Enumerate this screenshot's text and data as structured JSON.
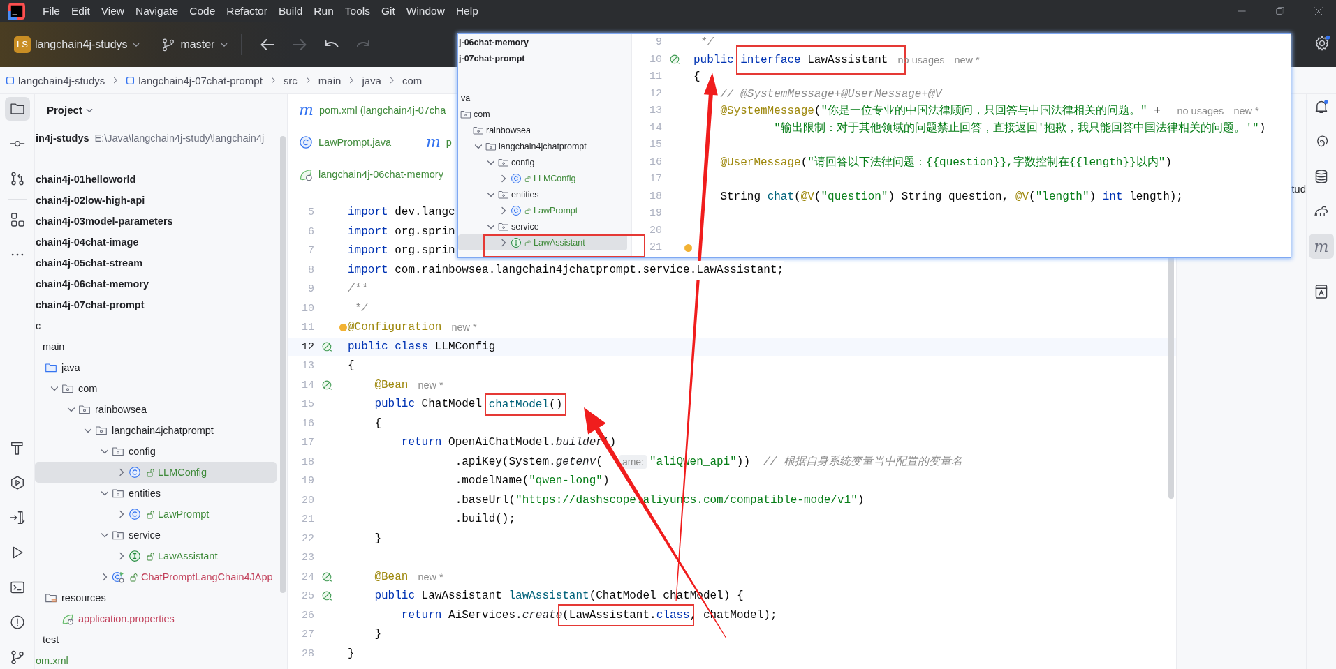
{
  "menu": [
    "File",
    "Edit",
    "View",
    "Navigate",
    "Code",
    "Refactor",
    "Build",
    "Run",
    "Tools",
    "Git",
    "Window",
    "Help"
  ],
  "toolbar": {
    "project_badge": "LS",
    "project": "langchain4j-studys",
    "branch": "master",
    "nav_buttons": [
      {
        "kind": "back",
        "disabled": false
      },
      {
        "kind": "forward",
        "disabled": true
      },
      {
        "kind": "undo",
        "disabled": false
      },
      {
        "kind": "redo",
        "disabled": true
      }
    ]
  },
  "breadcrumbs": [
    {
      "label": "langchain4j-studys",
      "kind": "module"
    },
    {
      "label": "langchain4j-07chat-prompt",
      "kind": "module"
    },
    {
      "label": "src"
    },
    {
      "label": "main"
    },
    {
      "label": "java"
    },
    {
      "label": "com"
    }
  ],
  "left_toolbar": {
    "top": [
      {
        "kind": "project",
        "selected": true
      },
      {
        "kind": "commit",
        "selected": false
      },
      {
        "kind": "pull_requests",
        "selected": false
      },
      {
        "kind": "structure",
        "selected": false
      },
      {
        "kind": "more",
        "selected": false
      }
    ],
    "bottom": [
      {
        "kind": "build",
        "selected": false
      },
      {
        "kind": "services",
        "selected": false
      },
      {
        "kind": "deploy",
        "selected": false
      },
      {
        "kind": "run",
        "selected": false
      },
      {
        "kind": "terminal",
        "selected": false
      },
      {
        "kind": "problems",
        "selected": false
      },
      {
        "kind": "git",
        "selected": false
      }
    ]
  },
  "project_panel": {
    "title": "Project",
    "tree": [
      {
        "label": "in4j-studys",
        "kind": "project",
        "path": "E:\\Java\\langchain4j-study\\langchain4j",
        "selected": false,
        "children": [
          {
            "label": "chain4j-01helloworld",
            "kind": "module",
            "selected": false
          },
          {
            "label": "chain4j-02low-high-api",
            "kind": "module",
            "selected": false
          },
          {
            "label": "chain4j-03model-parameters",
            "kind": "module",
            "selected": false
          },
          {
            "label": "chain4j-04chat-image",
            "kind": "module",
            "selected": false
          },
          {
            "label": "chain4j-05chat-stream",
            "kind": "module",
            "selected": false
          },
          {
            "label": "chain4j-06chat-memory",
            "kind": "module",
            "selected": false
          },
          {
            "label": "chain4j-07chat-prompt",
            "kind": "module",
            "selected": false,
            "children": [
              {
                "label": "c",
                "selected": false,
                "children": [
                  {
                    "label": "main",
                    "selected": false,
                    "children": [
                      {
                        "label": "java",
                        "kind": "source_root",
                        "selected": false,
                        "children": [
                          {
                            "label": "com",
                            "kind": "package",
                            "expanded": true,
                            "selected": false,
                            "children": [
                              {
                                "label": "rainbowsea",
                                "kind": "package",
                                "expanded": true,
                                "selected": false,
                                "children": [
                                  {
                                    "label": "langchain4jchatprompt",
                                    "kind": "package",
                                    "expanded": true,
                                    "selected": false,
                                    "children": [
                                      {
                                        "label": "config",
                                        "kind": "package",
                                        "expanded": true,
                                        "selected": false,
                                        "children": [
                                          {
                                            "label": "LLMConfig",
                                            "kind": "class",
                                            "expanded": false,
                                            "selected": true,
                                            "color": "#3f8a3a"
                                          }
                                        ]
                                      },
                                      {
                                        "label": "entities",
                                        "kind": "package",
                                        "expanded": true,
                                        "selected": false,
                                        "children": [
                                          {
                                            "label": "LawPrompt",
                                            "kind": "class",
                                            "expanded": false,
                                            "selected": false,
                                            "color": "#3f8a3a"
                                          }
                                        ]
                                      },
                                      {
                                        "label": "service",
                                        "kind": "package",
                                        "expanded": true,
                                        "selected": false,
                                        "children": [
                                          {
                                            "label": "LawAssistant",
                                            "kind": "interface",
                                            "expanded": false,
                                            "selected": false,
                                            "color": "#3f8a3a"
                                          }
                                        ]
                                      },
                                      {
                                        "label": "ChatPromptLangChain4JApp",
                                        "kind": "app",
                                        "expanded": false,
                                        "selected": false,
                                        "color": "#c2415b"
                                      }
                                    ]
                                  }
                                ]
                              }
                            ]
                          }
                        ]
                      },
                      {
                        "label": "resources",
                        "kind": "resources",
                        "selected": false,
                        "children": [
                          {
                            "label": "application.properties",
                            "kind": "properties",
                            "selected": false,
                            "color": "#c2415b"
                          }
                        ]
                      }
                    ]
                  },
                  {
                    "label": "test",
                    "selected": false
                  }
                ]
              },
              {
                "label": "om.xml",
                "selected": false,
                "color": "#3f8a3a"
              }
            ]
          }
        ]
      }
    ]
  },
  "editor": {
    "tab_rows": [
      [
        {
          "kind": "maven",
          "icon_text": "m",
          "label": "pom.xml (langchain4j-07cha"
        }
      ],
      [
        {
          "kind": "class",
          "label": "LawPrompt.java"
        },
        {
          "kind": "maven",
          "icon_text": "m",
          "label": "p"
        }
      ],
      [
        {
          "kind": "spring",
          "label": "langchain4j-06chat-memory"
        }
      ]
    ],
    "lines": [
      {
        "number": "5",
        "current": false,
        "segments": [
          {
            "kind": "keyword",
            "text": "import"
          },
          {
            "kind": "plain",
            "text": " dev.langc"
          }
        ]
      },
      {
        "number": "6",
        "current": false,
        "segments": [
          {
            "kind": "keyword",
            "text": "import"
          },
          {
            "kind": "plain",
            "text": " org.sprin"
          }
        ]
      },
      {
        "number": "7",
        "current": false,
        "segments": [
          {
            "kind": "keyword",
            "text": "import"
          },
          {
            "kind": "plain",
            "text": " org.sprin"
          }
        ]
      },
      {
        "number": "8",
        "current": false,
        "segments": [
          {
            "kind": "keyword",
            "text": "import"
          },
          {
            "kind": "plain",
            "text": " com.rainbowsea.langchain4jchatprompt.service.LawAssistant;"
          }
        ]
      },
      {
        "number": "9",
        "current": false,
        "segments": [
          {
            "kind": "comment",
            "text": "/**"
          }
        ]
      },
      {
        "number": "10",
        "current": false,
        "segments": [
          {
            "kind": "comment",
            "text": " */"
          }
        ]
      },
      {
        "number": "11",
        "current": false,
        "marker": {
          "kind": "bulb"
        },
        "segments": [
          {
            "kind": "annotation",
            "text": "@Configuration"
          },
          {
            "kind": "hint",
            "text": "new *"
          }
        ]
      },
      {
        "number": "12",
        "current": true,
        "gutter": {
          "kind": "bean"
        },
        "segments": [
          {
            "kind": "keyword",
            "text": "public class"
          },
          {
            "kind": "plain",
            "text": " LLMConfig"
          }
        ]
      },
      {
        "number": "13",
        "current": false,
        "segments": [
          {
            "kind": "plain",
            "text": "{"
          }
        ]
      },
      {
        "number": "14",
        "current": false,
        "gutter": {
          "kind": "bean"
        },
        "segments": [
          {
            "kind": "annotation",
            "text": "    @Bean"
          },
          {
            "kind": "hint",
            "text": "new *"
          }
        ]
      },
      {
        "number": "15",
        "current": false,
        "segments": [
          {
            "kind": "keyword",
            "text": "    public",
            "framed": false
          },
          {
            "kind": "plain",
            "text": " ChatModel ",
            "framed": false
          },
          {
            "kind": "method",
            "text": "chatModel",
            "framed": true
          },
          {
            "kind": "plain",
            "text": "()",
            "framed": true
          }
        ]
      },
      {
        "number": "16",
        "current": false,
        "segments": [
          {
            "kind": "plain",
            "text": "    {"
          }
        ]
      },
      {
        "number": "17",
        "current": false,
        "segments": [
          {
            "kind": "keyword",
            "text": "        return"
          },
          {
            "kind": "plain",
            "text": " OpenAiChatModel."
          },
          {
            "kind": "italic",
            "text": "builder"
          },
          {
            "kind": "plain",
            "text": "()"
          }
        ]
      },
      {
        "number": "18",
        "current": false,
        "segments": [
          {
            "kind": "plain",
            "text": "                .apiKey(System."
          },
          {
            "kind": "italic",
            "text": "getenv"
          },
          {
            "kind": "plain",
            "text": "("
          },
          {
            "kind": "param_hint",
            "text": "ame:"
          },
          {
            "kind": "string",
            "text": "\"aliQwen_api\""
          },
          {
            "kind": "plain",
            "text": "))  "
          },
          {
            "kind": "comment",
            "text": "// 根据自身系统变量当中配置的变量名"
          }
        ]
      },
      {
        "number": "19",
        "current": false,
        "segments": [
          {
            "kind": "plain",
            "text": "                .modelName("
          },
          {
            "kind": "string",
            "text": "\"qwen-long\""
          },
          {
            "kind": "plain",
            "text": ")"
          }
        ]
      },
      {
        "number": "20",
        "current": false,
        "segments": [
          {
            "kind": "plain",
            "text": "                .baseUrl("
          },
          {
            "kind": "string",
            "text": "\""
          },
          {
            "kind": "link",
            "text": "https://dashscope.aliyuncs.com/compatible-mode/v1"
          },
          {
            "kind": "string",
            "text": "\""
          },
          {
            "kind": "plain",
            "text": ")"
          }
        ]
      },
      {
        "number": "21",
        "current": false,
        "segments": [
          {
            "kind": "plain",
            "text": "                .build();"
          }
        ]
      },
      {
        "number": "22",
        "current": false,
        "segments": [
          {
            "kind": "plain",
            "text": "    }"
          }
        ]
      },
      {
        "number": "23",
        "current": false
      },
      {
        "number": "24",
        "current": false,
        "gutter": {
          "kind": "bean"
        },
        "segments": [
          {
            "kind": "annotation",
            "text": "    @Bean"
          },
          {
            "kind": "hint",
            "text": "new *"
          }
        ]
      },
      {
        "number": "25",
        "current": false,
        "gutter": {
          "kind": "bean"
        },
        "segments": [
          {
            "kind": "keyword",
            "text": "    public"
          },
          {
            "kind": "plain",
            "text": " LawAssistant "
          },
          {
            "kind": "method",
            "text": "lawAssistant"
          },
          {
            "kind": "plain",
            "text": "(ChatModel chatModel) {"
          }
        ]
      },
      {
        "number": "26",
        "current": false,
        "segments": [
          {
            "kind": "keyword",
            "text": "        return",
            "framed": false
          },
          {
            "kind": "plain",
            "text": " AiServices.",
            "framed": false
          },
          {
            "kind": "italic",
            "text": "create",
            "framed": false
          },
          {
            "kind": "plain",
            "text": "(LawAssistant.",
            "framed": true
          },
          {
            "kind": "keyword",
            "text": "class",
            "framed": true
          },
          {
            "kind": "plain",
            "text": ", chatModel);",
            "framed": false
          }
        ]
      },
      {
        "number": "27",
        "current": false,
        "segments": [
          {
            "kind": "plain",
            "text": "    }"
          }
        ]
      },
      {
        "number": "28",
        "current": false,
        "segments": [
          {
            "kind": "plain",
            "text": "}"
          }
        ]
      }
    ]
  },
  "right_panel": {
    "text": "tud"
  },
  "right_toolbar": [
    {
      "kind": "notifications",
      "selected": false
    },
    {
      "kind": "ai",
      "selected": false
    },
    {
      "kind": "database",
      "selected": false
    },
    {
      "kind": "gradle",
      "selected": false
    },
    {
      "kind": "maven",
      "label": "m",
      "selected": true
    },
    {
      "kind": "docs",
      "selected": false
    }
  ],
  "popup": {
    "tree": [
      {
        "label": "j-06chat-memory",
        "kind": "module",
        "selected": false
      },
      {
        "label": "j-07chat-prompt",
        "kind": "module",
        "selected": false,
        "children": [
          {
            "label": "va",
            "selected": false,
            "children": [
              {
                "label": "com",
                "kind": "package",
                "selected": false,
                "children": [
                  {
                    "label": "rainbowsea",
                    "kind": "package",
                    "selected": false,
                    "children": [
                      {
                        "label": "langchain4jchatprompt",
                        "kind": "package",
                        "expanded": true,
                        "selected": false,
                        "children": [
                          {
                            "label": "config",
                            "kind": "package",
                            "expanded": true,
                            "selected": false,
                            "children": [
                              {
                                "label": "LLMConfig",
                                "kind": "class",
                                "expanded": false,
                                "selected": false,
                                "color": "#3f8a3a"
                              }
                            ]
                          },
                          {
                            "label": "entities",
                            "kind": "package",
                            "expanded": true,
                            "selected": false,
                            "children": [
                              {
                                "label": "LawPrompt",
                                "kind": "class",
                                "expanded": false,
                                "selected": false,
                                "color": "#3f8a3a"
                              }
                            ]
                          },
                          {
                            "label": "service",
                            "kind": "package",
                            "expanded": true,
                            "selected": false,
                            "children": [
                              {
                                "label": "LawAssistant",
                                "kind": "interface",
                                "expanded": false,
                                "selected": true,
                                "color": "#3f8a3a"
                              }
                            ]
                          }
                        ]
                      }
                    ]
                  }
                ]
              }
            ]
          }
        ]
      }
    ],
    "lines": [
      {
        "number": "9",
        "segments": [
          {
            "kind": "comment",
            "text": " */"
          }
        ]
      },
      {
        "number": "10",
        "gutter": {
          "kind": "bean"
        },
        "segments": [
          {
            "kind": "keyword",
            "text": "public ",
            "framed": false
          },
          {
            "kind": "keyword",
            "text": "interface",
            "framed": true
          },
          {
            "kind": "plain",
            "text": " LawAssistant",
            "framed": true
          },
          {
            "kind": "hint",
            "text": "no usages"
          },
          {
            "kind": "hint",
            "text": "new *"
          }
        ]
      },
      {
        "number": "11",
        "segments": [
          {
            "kind": "plain",
            "text": "{"
          }
        ]
      },
      {
        "number": "12",
        "segments": [
          {
            "kind": "comment",
            "text": "    // @SystemMessage+@UserMessage+@V"
          }
        ]
      },
      {
        "number": "13",
        "segments": [
          {
            "kind": "annotation",
            "text": "    @SystemMessage"
          },
          {
            "kind": "plain",
            "text": "("
          },
          {
            "kind": "string",
            "text": "\"你是一位专业的中国法律顾问，只回答与中国法律相关的问题。\""
          },
          {
            "kind": "plain",
            "text": " + "
          },
          {
            "kind": "hint",
            "text": "no usages"
          },
          {
            "kind": "hint",
            "text": "new *"
          }
        ]
      },
      {
        "number": "14",
        "segments": [
          {
            "kind": "string",
            "text": "            \"输出限制：对于其他领域的问题禁止回答，直接返回'抱歉，我只能回答中国法律相关的问题。'\""
          },
          {
            "kind": "plain",
            "text": ")"
          }
        ]
      },
      {
        "number": "15"
      },
      {
        "number": "16",
        "segments": [
          {
            "kind": "annotation",
            "text": "    @UserMessage"
          },
          {
            "kind": "plain",
            "text": "("
          },
          {
            "kind": "string",
            "text": "\"请回答以下法律问题：{{question}},字数控制在{{length}}以内\""
          },
          {
            "kind": "plain",
            "text": ")"
          }
        ]
      },
      {
        "number": "17"
      },
      {
        "number": "18",
        "segments": [
          {
            "kind": "plain",
            "text": "    String "
          },
          {
            "kind": "method",
            "text": "chat"
          },
          {
            "kind": "plain",
            "text": "("
          },
          {
            "kind": "annotation",
            "text": "@V"
          },
          {
            "kind": "plain",
            "text": "("
          },
          {
            "kind": "string",
            "text": "\"question\""
          },
          {
            "kind": "plain",
            "text": ") String question, "
          },
          {
            "kind": "annotation",
            "text": "@V"
          },
          {
            "kind": "plain",
            "text": "("
          },
          {
            "kind": "string",
            "text": "\"length\""
          },
          {
            "kind": "plain",
            "text": ") "
          },
          {
            "kind": "keyword",
            "text": "int"
          },
          {
            "kind": "plain",
            "text": " length);"
          }
        ]
      },
      {
        "number": "19"
      },
      {
        "number": "20"
      },
      {
        "number": "21",
        "marker": {
          "kind": "bulb"
        }
      }
    ]
  }
}
